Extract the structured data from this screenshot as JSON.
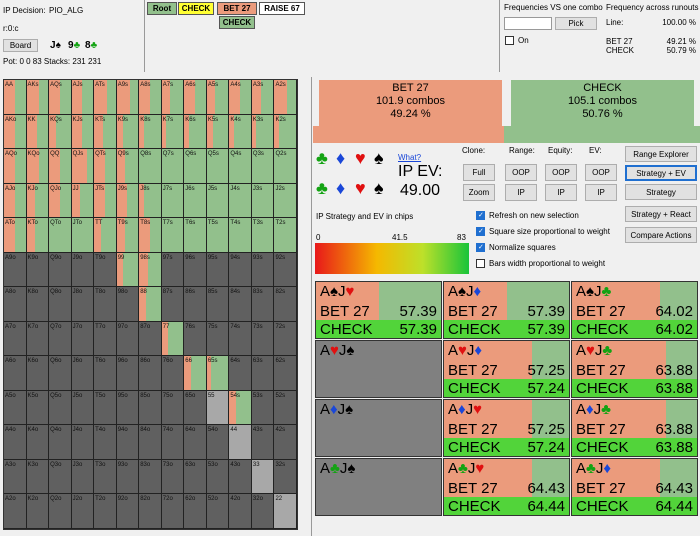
{
  "info": {
    "decision": "IP Decision:",
    "decision_value": "PIO_ALG",
    "r0c": "r:0:c",
    "board_button": "Board",
    "board_cards": [
      {
        "rank": "J",
        "suit": "♠",
        "color": "#000000"
      },
      {
        "rank": "9",
        "suit": "♣",
        "color": "#13a313"
      },
      {
        "rank": "8",
        "suit": "♣",
        "color": "#13a313"
      }
    ],
    "pot": "Pot: 0 0 83 Stacks: 231 231"
  },
  "tree": {
    "root": "Root",
    "check1": "CHECK",
    "bet": "BET 27",
    "raise": "RAISE 67",
    "check2": "CHECK"
  },
  "freq": {
    "vs_title": "Frequencies VS one combo",
    "pick": "Pick",
    "on": "On",
    "across_title": "Frequency across runouts",
    "line": "Line:",
    "line_value": "100.00 %",
    "bet_label": "BET 27",
    "bet_value": "49.21 %",
    "check_label": "CHECK",
    "check_value": "50.79 %"
  },
  "summary": {
    "bet_label": "BET 27",
    "bet_combos": "101.9 combos",
    "bet_pct": "49.24 %",
    "bet_frac": 0.4924,
    "check_label": "CHECK",
    "check_combos": "105.1 combos",
    "check_pct": "50.76 %"
  },
  "ev": {
    "what": "What?",
    "label": "IP EV:",
    "value": "49.00",
    "legend_title": "IP Strategy and EV in chips",
    "min": "0",
    "mid": "41.5",
    "max": "83"
  },
  "controls": {
    "clone": "Clone:",
    "range": "Range:",
    "equity": "Equity:",
    "ev": "EV:",
    "full": "Full",
    "zoom": "Zoom",
    "oop": "OOP",
    "ip": "IP",
    "range_explorer": "Range Explorer",
    "strategy_ev": "Strategy + EV",
    "strategy": "Strategy",
    "strategy_react": "Strategy + React",
    "compare": "Compare Actions"
  },
  "checks": [
    {
      "label": "Refresh on new selection",
      "on": true
    },
    {
      "label": "Square size proportional to weight",
      "on": true
    },
    {
      "label": "Normalize squares",
      "on": true
    },
    {
      "label": "Bars width proportional to weight",
      "on": false
    }
  ],
  "combos": [
    {
      "c1": "A",
      "s1": "♠",
      "k1": "black",
      "c2": "J",
      "s2": "♥",
      "k2": "red",
      "bet": "BET 27",
      "bet_ev": "57.39",
      "check": "CHECK",
      "check_ev": "57.39",
      "bet_frac": 0.5
    },
    {
      "c1": "A",
      "s1": "♠",
      "k1": "black",
      "c2": "J",
      "s2": "♦",
      "k2": "blue",
      "bet": "BET 27",
      "bet_ev": "57.39",
      "check": "CHECK",
      "check_ev": "57.39",
      "bet_frac": 0.5
    },
    {
      "c1": "A",
      "s1": "♠",
      "k1": "black",
      "c2": "J",
      "s2": "♣",
      "k2": "green",
      "bet": "BET 27",
      "bet_ev": "64.02",
      "check": "CHECK",
      "check_ev": "64.02",
      "bet_frac": 0.7
    },
    {
      "c1": "A",
      "s1": "♥",
      "k1": "red",
      "c2": "J",
      "s2": "♠",
      "k2": "black",
      "bet": "",
      "bet_ev": "",
      "check": "",
      "check_ev": "",
      "bet_frac": 0
    },
    {
      "c1": "A",
      "s1": "♥",
      "k1": "red",
      "c2": "J",
      "s2": "♦",
      "k2": "blue",
      "bet": "BET 27",
      "bet_ev": "57.25",
      "check": "CHECK",
      "check_ev": "57.24",
      "bet_frac": 0.7
    },
    {
      "c1": "A",
      "s1": "♥",
      "k1": "red",
      "c2": "J",
      "s2": "♣",
      "k2": "green",
      "bet": "BET 27",
      "bet_ev": "63.88",
      "check": "CHECK",
      "check_ev": "63.88",
      "bet_frac": 0.75
    },
    {
      "c1": "A",
      "s1": "♦",
      "k1": "blue",
      "c2": "J",
      "s2": "♠",
      "k2": "black",
      "bet": "",
      "bet_ev": "",
      "check": "",
      "check_ev": "",
      "bet_frac": 0
    },
    {
      "c1": "A",
      "s1": "♦",
      "k1": "blue",
      "c2": "J",
      "s2": "♥",
      "k2": "red",
      "bet": "BET 27",
      "bet_ev": "57.25",
      "check": "CHECK",
      "check_ev": "57.24",
      "bet_frac": 0.7
    },
    {
      "c1": "A",
      "s1": "♦",
      "k1": "blue",
      "c2": "J",
      "s2": "♣",
      "k2": "green",
      "bet": "BET 27",
      "bet_ev": "63.88",
      "check": "CHECK",
      "check_ev": "63.88",
      "bet_frac": 0.75
    },
    {
      "c1": "A",
      "s1": "♣",
      "k1": "green",
      "c2": "J",
      "s2": "♠",
      "k2": "black",
      "bet": "",
      "bet_ev": "",
      "check": "",
      "check_ev": "",
      "bet_frac": 0
    },
    {
      "c1": "A",
      "s1": "♣",
      "k1": "green",
      "c2": "J",
      "s2": "♥",
      "k2": "red",
      "bet": "BET 27",
      "bet_ev": "64.43",
      "check": "CHECK",
      "check_ev": "64.44",
      "bet_frac": 0.7
    },
    {
      "c1": "A",
      "s1": "♣",
      "k1": "green",
      "c2": "J",
      "s2": "♦",
      "k2": "blue",
      "bet": "BET 27",
      "bet_ev": "64.43",
      "check": "CHECK",
      "check_ev": "64.44",
      "bet_frac": 0.7
    }
  ],
  "colors": {
    "bet": "#eb9b7c",
    "check": "#92c08c",
    "empty": "#606060",
    "pair_bg": "#a8a8a8"
  },
  "grid": {
    "ranks": [
      "A",
      "K",
      "Q",
      "J",
      "T",
      "9",
      "8",
      "7",
      "6",
      "5",
      "4",
      "3",
      "2"
    ],
    "bet_frac": [
      [
        0.5,
        0.6,
        0.5,
        0.5,
        0.6,
        0.6,
        0.5,
        0.4,
        0.5,
        0.4,
        0.5,
        0.4,
        0.6
      ],
      [
        0.5,
        0.5,
        0.3,
        0.5,
        0.4,
        0.3,
        0.2,
        0.2,
        0.2,
        0.3,
        0.2,
        0.2,
        0.2
      ],
      [
        0.5,
        0.6,
        0.5,
        0.7,
        0.5,
        0.4,
        0,
        0,
        0,
        0,
        0,
        0,
        0
      ],
      [
        0.5,
        0.4,
        0.5,
        0.4,
        0.5,
        0.5,
        0.2,
        0,
        0,
        0,
        0,
        0,
        0
      ],
      [
        0.5,
        0.4,
        0,
        0,
        0.3,
        0.4,
        0.5,
        0,
        0,
        0,
        0,
        0,
        0
      ],
      [
        0,
        0,
        0,
        0,
        0,
        0.3,
        0.4,
        0,
        0,
        0,
        0,
        0,
        0
      ],
      [
        0,
        0,
        0,
        0,
        0,
        0.4,
        0.3,
        0,
        0,
        0,
        0,
        0,
        0
      ],
      [
        0,
        0,
        0,
        0,
        0,
        0,
        0,
        0.3,
        0,
        0,
        0,
        0,
        0
      ],
      [
        0,
        0,
        0,
        0,
        0,
        0,
        0,
        0.3,
        0.3,
        0.2,
        0,
        0,
        0
      ],
      [
        0,
        0,
        0,
        0,
        0,
        0,
        0,
        0,
        0,
        0.3,
        0.3,
        0,
        0
      ],
      [
        0,
        0,
        0,
        0,
        0,
        0,
        0,
        0,
        0,
        0,
        0.3,
        0,
        0
      ],
      [
        0,
        0,
        0,
        0,
        0,
        0,
        0,
        0,
        0,
        0,
        0,
        0,
        0
      ],
      [
        0,
        0,
        0,
        0,
        0,
        0,
        0,
        0,
        0,
        0,
        0,
        0,
        0
      ]
    ],
    "active": [
      [
        1,
        1,
        1,
        1,
        1,
        1,
        1,
        1,
        1,
        1,
        1,
        1,
        1
      ],
      [
        1,
        1,
        1,
        1,
        1,
        1,
        1,
        1,
        1,
        1,
        1,
        1,
        1
      ],
      [
        1,
        1,
        1,
        1,
        1,
        1,
        1,
        1,
        1,
        1,
        1,
        1,
        1
      ],
      [
        1,
        1,
        1,
        1,
        1,
        1,
        1,
        1,
        1,
        1,
        1,
        1,
        1
      ],
      [
        1,
        1,
        1,
        1,
        1,
        1,
        1,
        1,
        1,
        1,
        1,
        1,
        1
      ],
      [
        0,
        0,
        0,
        0,
        0,
        1,
        1,
        1,
        1,
        1,
        1,
        1,
        1
      ],
      [
        0,
        0,
        0,
        0,
        0,
        0,
        1,
        1,
        1,
        1,
        1,
        1,
        1
      ],
      [
        0,
        0,
        0,
        0,
        0,
        0,
        0,
        1,
        1,
        1,
        1,
        1,
        1
      ],
      [
        0,
        0,
        0,
        0,
        0,
        0,
        0,
        0,
        1,
        1,
        1,
        1,
        1
      ],
      [
        0,
        0,
        0,
        0,
        0,
        0,
        0,
        0,
        0,
        1,
        1,
        1,
        1
      ],
      [
        0,
        0,
        0,
        0,
        0,
        0,
        0,
        0,
        0,
        0,
        1,
        1,
        1
      ],
      [
        0,
        0,
        0,
        0,
        0,
        0,
        0,
        0,
        0,
        0,
        0,
        1,
        1
      ],
      [
        0,
        0,
        0,
        0,
        0,
        0,
        0,
        0,
        0,
        0,
        0,
        0,
        1
      ]
    ]
  }
}
